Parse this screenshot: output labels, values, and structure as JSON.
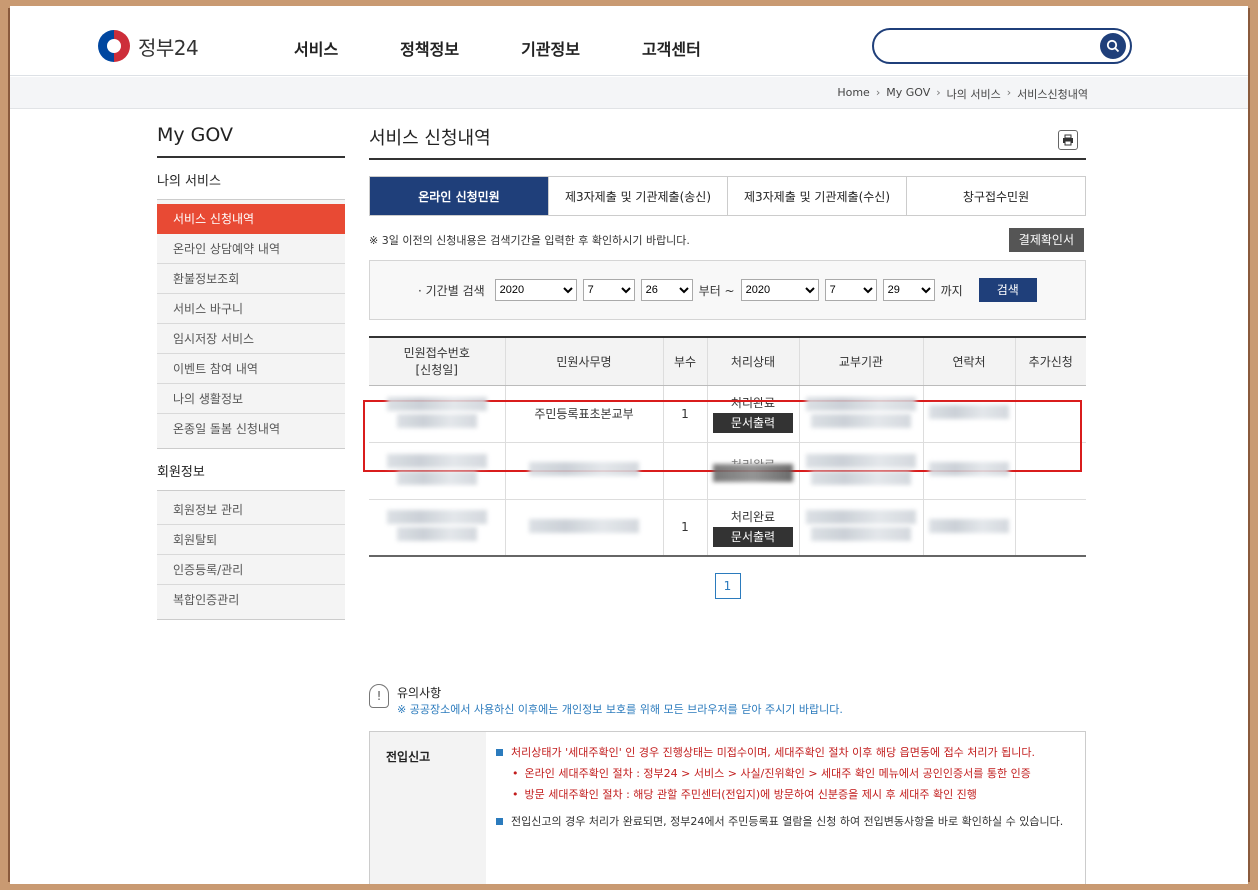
{
  "header": {
    "logo_text": "정부24",
    "nav": [
      "서비스",
      "정책정보",
      "기관정보",
      "고객센터"
    ],
    "search_placeholder": ""
  },
  "breadcrumb": [
    "Home",
    "My GOV",
    "나의 서비스",
    "서비스신청내역"
  ],
  "sidebar": {
    "title": "My GOV",
    "section1": "나의 서비스",
    "items1": [
      "서비스 신청내역",
      "온라인 상담예약 내역",
      "환불정보조회",
      "서비스 바구니",
      "임시저장 서비스",
      "이벤트 참여 내역",
      "나의 생활정보",
      "온종일 돌봄 신청내역"
    ],
    "section2": "회원정보",
    "items2": [
      "회원정보 관리",
      "회원탈퇴",
      "인증등록/관리",
      "복합인증관리"
    ]
  },
  "main": {
    "title": "서비스 신청내역",
    "tabs": [
      "온라인 신청민원",
      "제3자제출 및 기관제출(송신)",
      "제3자제출 및 기관제출(수신)",
      "창구접수민원"
    ],
    "notice": "※ 3일 이전의 신청내용은 검색기간을 입력한 후 확인하시기 바랍니다.",
    "receipt_button": "결제확인서",
    "filter": {
      "label": "· 기간별 검색",
      "from_year": "2020",
      "from_month": "7",
      "from_day": "26",
      "from_text": "부터 ~",
      "to_year": "2020",
      "to_month": "7",
      "to_day": "29",
      "to_text": "까지",
      "search_button": "검색"
    },
    "table": {
      "headers": [
        "민원접수번호\n[신청일]",
        "민원사무명",
        "부수",
        "처리상태",
        "교부기관",
        "연락처",
        "추가신청"
      ],
      "rows": [
        {
          "service": "주민등록표초본교부",
          "count": "1",
          "status": "처리완료",
          "button": "문서출력"
        },
        {
          "service": "",
          "count": "",
          "status": "처리완료",
          "button": "문서출력"
        },
        {
          "service": "",
          "count": "1",
          "status": "처리완료",
          "button": "문서출력"
        }
      ]
    },
    "pager": [
      "1"
    ]
  },
  "caution": {
    "title": "유의사항",
    "subtitle": "※ 공공장소에서 사용하신 이후에는 개인정보 보호를 위해 모든 브라우저를 닫아 주시기 바랍니다.",
    "box_label": "전입신고",
    "line1": "처리상태가 '세대주확인' 인 경우 진행상태는 미접수이며, 세대주확인 절차 이후 해당 읍면동에 접수 처리가 됩니다.",
    "sub1": "온라인 세대주확인 절차 : 정부24 > 서비스 > 사실/진위확인 > 세대주 확인 메뉴에서 공인인증서를 통한 인증",
    "sub2": "방문 세대주확인 절차 : 해당 관할 주민센터(전입지)에 방문하여 신분증을 제시 후 세대주 확인 진행",
    "line2": "전입신고의 경우 처리가 완료되면, 정부24에서 주민등록표 열람을 신청 하여 전입변동사항을 바로 확인하실 수 있습니다."
  }
}
